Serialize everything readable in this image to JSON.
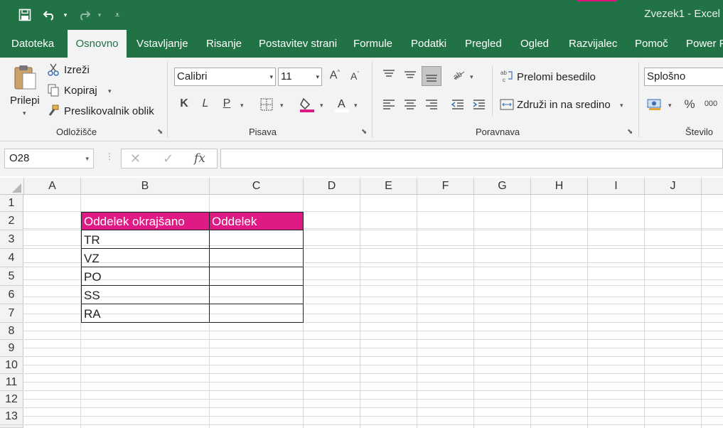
{
  "window": {
    "title": "Zvezek1  -  Excel"
  },
  "quick_access": {
    "save_icon": "save-icon",
    "undo_icon": "undo-icon",
    "redo_icon": "redo-icon",
    "customize_icon": "customize-icon"
  },
  "tabs": [
    {
      "label": "Datoteka"
    },
    {
      "label": "Osnovno"
    },
    {
      "label": "Vstavljanje"
    },
    {
      "label": "Risanje"
    },
    {
      "label": "Postavitev strani"
    },
    {
      "label": "Formule"
    },
    {
      "label": "Podatki"
    },
    {
      "label": "Pregled"
    },
    {
      "label": "Ogled"
    },
    {
      "label": "Razvijalec"
    },
    {
      "label": "Pomoč"
    },
    {
      "label": "Power P"
    }
  ],
  "ribbon": {
    "clipboard": {
      "paste": "Prilepi",
      "cut": "Izreži",
      "copy": "Kopiraj",
      "format_painter": "Preslikovalnik oblik",
      "group_label": "Odložišče"
    },
    "font": {
      "font_name": "Calibri",
      "font_size": "11",
      "bold": "K",
      "italic": "L",
      "underline": "P",
      "group_label": "Pisava"
    },
    "alignment": {
      "wrap_text": "Prelomi besedilo",
      "merge_center": "Združi in na sredino",
      "group_label": "Poravnava"
    },
    "number": {
      "format": "Splošno",
      "percent": "%",
      "thousands": "000",
      "group_label": "Število"
    }
  },
  "formula_bar": {
    "name_box": "O28",
    "fx": "fx",
    "formula": ""
  },
  "columns": [
    "A",
    "B",
    "C",
    "D",
    "E",
    "F",
    "G",
    "H",
    "I",
    "J"
  ],
  "rows": [
    "1",
    "2",
    "3",
    "4",
    "5",
    "6",
    "7",
    "8",
    "9",
    "10",
    "11",
    "12",
    "13"
  ],
  "table": {
    "header_b": "Oddelek okrajšano",
    "header_c": "Oddelek",
    "values_b": [
      "TR",
      "VZ",
      "PO",
      "SS",
      "RA"
    ],
    "values_c": [
      "",
      "",
      "",
      "",
      ""
    ]
  },
  "colors": {
    "brand": "#217346",
    "table_header": "#e01a84"
  }
}
